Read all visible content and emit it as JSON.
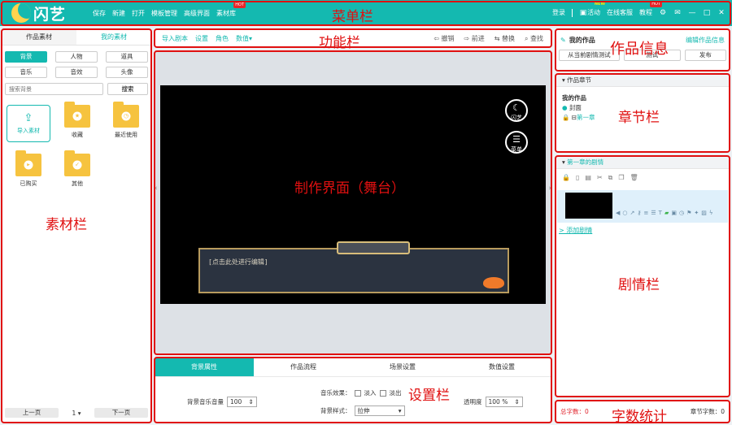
{
  "app": {
    "logo_text": "闪艺"
  },
  "menubar": {
    "items": [
      "保存",
      "新建",
      "打开",
      "模板管理",
      "高级界面",
      "素材库"
    ],
    "hot_badge": "HOT",
    "login": "登录",
    "activity": "活动",
    "new_badge": "NEW",
    "online_service": "在线客服",
    "tutorial": "教程",
    "tutorial_badge": "HOT"
  },
  "annotations": {
    "menubar": "菜单栏",
    "toolbar": "功能栏",
    "work_info": "作品信息",
    "chapters": "章节栏",
    "stage": "制作界面（舞台）",
    "assets": "素材栏",
    "plot": "剧情栏",
    "settings": "设置栏",
    "wordcount": "字数统计"
  },
  "left_panel": {
    "tabs": [
      "作品素材",
      "我的素材"
    ],
    "categories": [
      "背景",
      "人物",
      "道具",
      "音乐",
      "音效",
      "头像"
    ],
    "search_placeholder": "搜索背景",
    "search_button": "搜索",
    "folders": [
      {
        "label": "导入素材",
        "icon": "upload-icon"
      },
      {
        "label": "收藏",
        "icon": "star-icon"
      },
      {
        "label": "最近使用",
        "icon": "clock-icon"
      },
      {
        "label": "已购买",
        "icon": "truck-icon"
      },
      {
        "label": "其他",
        "icon": "check-icon"
      }
    ],
    "prev_page": "上一页",
    "page": "1",
    "next_page": "下一页"
  },
  "toolbar": {
    "left": [
      "导入剧本",
      "设置",
      "角色",
      "数值▾"
    ],
    "undo": "撤销",
    "redo": "前进",
    "replace": "替换",
    "find": "查找"
  },
  "stage": {
    "logo_button": "闪艺",
    "menu_button": "菜单",
    "dialog_placeholder": "[点击此处进行编辑]"
  },
  "settings": {
    "tabs": [
      "背景属性",
      "作品流程",
      "场景设置",
      "数值设置"
    ],
    "bg_music_volume_label": "背景音乐音量",
    "bg_music_volume": "100",
    "music_effect_label": "音乐效果：",
    "fade_in": "淡入",
    "fade_out": "淡出",
    "opacity_label": "透明度",
    "opacity_value": "100 %",
    "bg_style_label": "背景样式：",
    "bg_style_value": "拉伸"
  },
  "work_info": {
    "title": "我的作品",
    "edit_link": "编辑作品信息",
    "buttons": [
      "从当前剧情测试",
      "测试",
      "发布"
    ]
  },
  "chapters": {
    "header": "作品章节",
    "work": "我的作品",
    "cover": "封面",
    "chapter1": "第一章"
  },
  "plot": {
    "header": "第一章的剧情",
    "add_link": "> 添加剧情"
  },
  "wordcount": {
    "total_label": "总字数：0",
    "chapter_label": "章节字数：0"
  },
  "colors": {
    "brand": "#14b9b0",
    "annotation": "#e01010"
  }
}
